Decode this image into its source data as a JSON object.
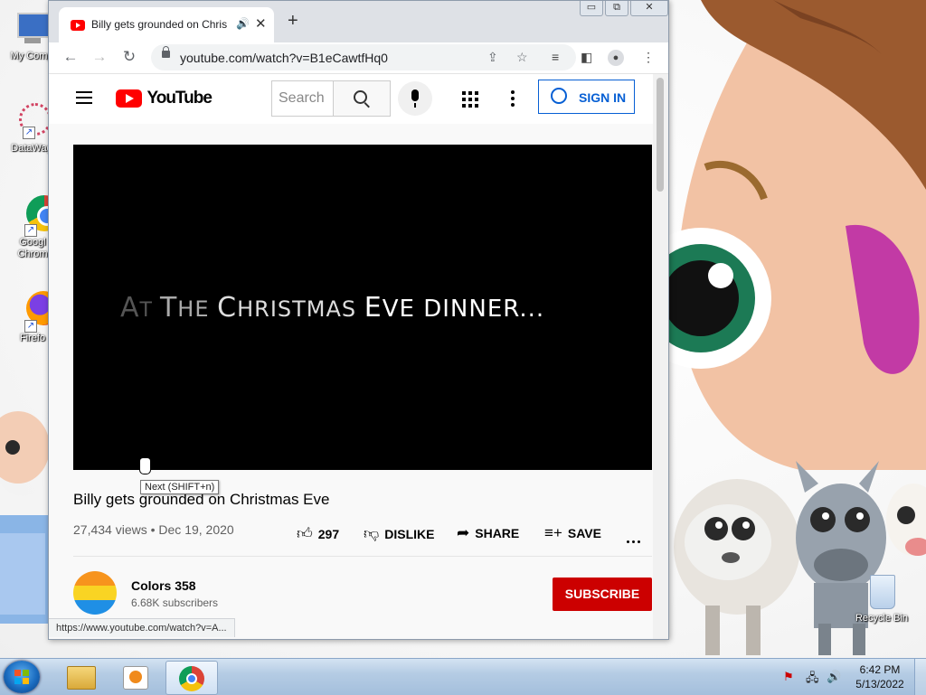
{
  "desktop": {
    "icons": [
      {
        "label": "My Comp",
        "icon": "computer-icon"
      },
      {
        "label": "DataWag",
        "icon": "datawag-icon"
      },
      {
        "label": "Googl Chrom",
        "icon": "chrome-icon"
      },
      {
        "label": "Firefo",
        "icon": "firefox-icon"
      }
    ],
    "recycle_bin": "Recycle Bin"
  },
  "browser": {
    "tab_title": "Billy gets grounded on Christmas Eve",
    "tab_audio_icon": "speaker-icon",
    "tab_close": "✕",
    "new_tab": "+",
    "window_controls": {
      "minimize": "▭",
      "maximize": "⧉",
      "close": "✕"
    },
    "url": "youtube.com/watch?v=B1eCawtfHq0",
    "status_url": "https://www.youtube.com/watch?v=A..."
  },
  "youtube": {
    "logo": "YouTube",
    "search_placeholder": "Search",
    "sign_in": "SIGN IN",
    "video_overlay": {
      "part1": "A",
      "part2": "T ",
      "part3": "T",
      "part4": "HE ",
      "part5": "C",
      "part6": "HRISTMAS ",
      "part7": "E",
      "part8": "VE DINNER..."
    },
    "tooltip": "Next (SHIFT+n)",
    "video_title": "Billy gets grounded on Christmas Eve",
    "views": "27,434 views",
    "date": "Dec 19, 2020",
    "likes": "297",
    "dislike": "DISLIKE",
    "share": "SHARE",
    "save": "SAVE",
    "channel_name": "Colors 358",
    "subscribers": "6.68K subscribers",
    "subscribe": "SUBSCRIBE",
    "avatar_colors": [
      "#f7941d",
      "#f9d423",
      "#1f8fe5"
    ]
  },
  "taskbar": {
    "time": "6:42 PM",
    "date": "5/13/2022"
  }
}
